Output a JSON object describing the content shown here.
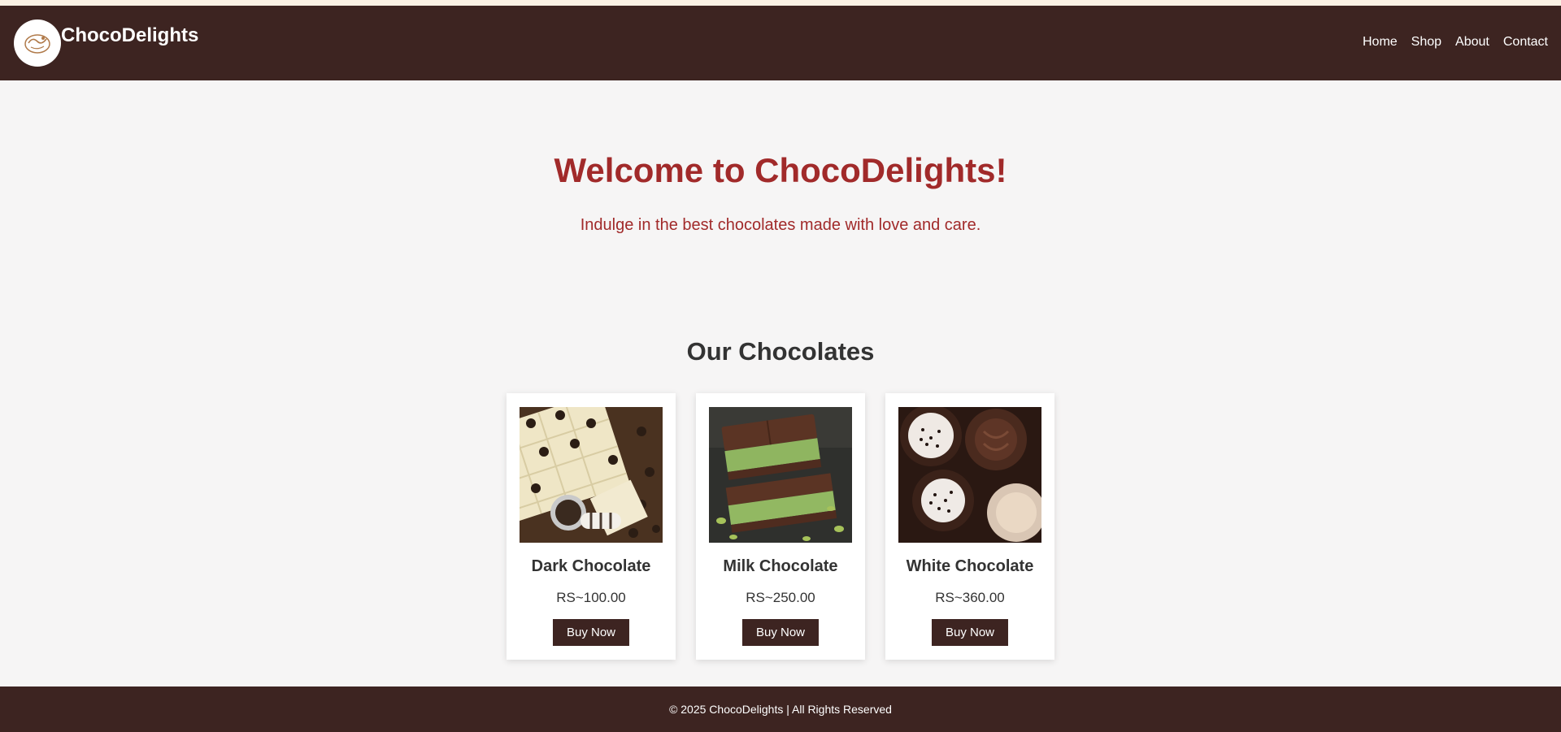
{
  "header": {
    "brand": "ChocoDelights",
    "logo_icon": "chocolate-logo-icon",
    "nav": [
      {
        "label": "Home"
      },
      {
        "label": "Shop"
      },
      {
        "label": "About"
      },
      {
        "label": "Contact"
      }
    ]
  },
  "hero": {
    "title": "Welcome to ChocoDelights!",
    "subtitle": "Indulge in the best chocolates made with love and care."
  },
  "products_section": {
    "title": "Our Chocolates",
    "items": [
      {
        "name": "Dark Chocolate",
        "price": "RS~100.00",
        "button": "Buy Now"
      },
      {
        "name": "Milk Chocolate",
        "price": "RS~250.00",
        "button": "Buy Now"
      },
      {
        "name": "White Chocolate",
        "price": "RS~360.00",
        "button": "Buy Now"
      }
    ]
  },
  "footer": {
    "text": "© 2025 ChocoDelights | All Rights Reserved"
  },
  "colors": {
    "header_bg": "#3d2421",
    "accent_red": "#a12a2a",
    "page_bg": "#f6f5f5"
  }
}
